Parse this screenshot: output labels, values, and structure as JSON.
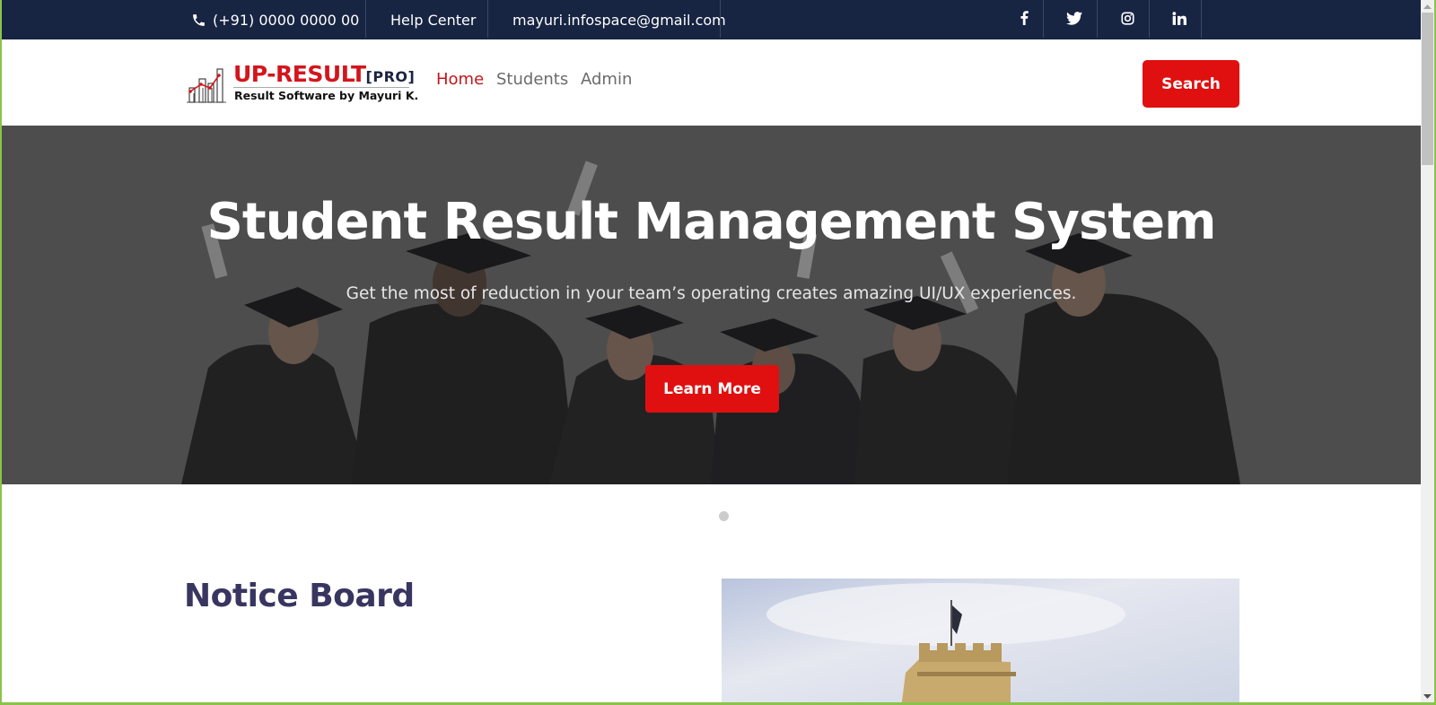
{
  "topbar": {
    "phone": "(+91) 0000 0000 00",
    "help": "Help Center",
    "email": "mayuri.infospace@gmail.com",
    "social": [
      {
        "name": "facebook",
        "glyph": "f"
      },
      {
        "name": "twitter",
        "glyph": "twitter"
      },
      {
        "name": "instagram",
        "glyph": "instagram"
      },
      {
        "name": "linkedin",
        "glyph": "in"
      }
    ]
  },
  "header": {
    "logo_title": "UP-RESULT",
    "logo_badge": "[PRO]",
    "logo_subtitle": "Result Software by Mayuri K.",
    "nav": [
      {
        "label": "Home",
        "active": true
      },
      {
        "label": "Students",
        "active": false
      },
      {
        "label": "Admin",
        "active": false
      }
    ],
    "search_label": "Search"
  },
  "hero": {
    "title": "Student Result Management System",
    "subtitle": "Get the most of reduction in your team’s operating creates amazing UI/UX experiences.",
    "cta_label": "Learn More",
    "slide_count": 1,
    "active_slide": 1
  },
  "notice": {
    "title": "Notice Board"
  },
  "colors": {
    "topbar_bg": "#172442",
    "accent_red": "#e01010",
    "heading_navy": "#383560",
    "frame_green": "#8bc34a"
  }
}
